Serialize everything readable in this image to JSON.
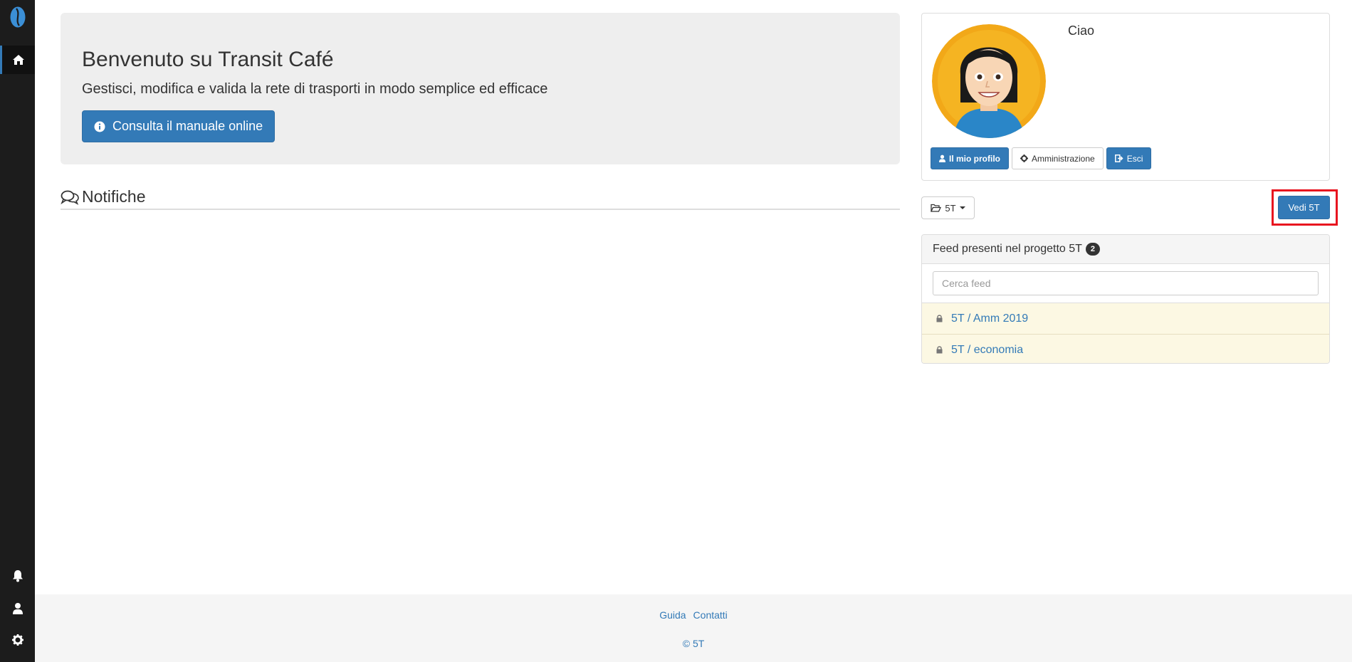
{
  "colors": {
    "sidebar": "#1c1c1c",
    "primary": "#337ab7",
    "highlight": "#e8141f",
    "feed_row": "#fcf8e3"
  },
  "sidebar": {
    "logo_icon": "coffee-bean-icon",
    "items": [
      {
        "icon": "home-icon"
      },
      {
        "icon": "bell-icon"
      },
      {
        "icon": "user-icon"
      },
      {
        "icon": "gear-icon"
      }
    ]
  },
  "jumbotron": {
    "title": "Benvenuto su Transit Café",
    "subtitle": "Gestisci, modifica e valida la rete di trasporti in modo semplice ed efficace",
    "manual_button": "Consulta il manuale online"
  },
  "notifications": {
    "title": "Notifiche"
  },
  "profile": {
    "greeting": "Ciao",
    "buttons": {
      "profile": "Il mio profilo",
      "admin": "Amministrazione",
      "logout": "Esci"
    }
  },
  "project": {
    "selected": "5T",
    "view_button": "Vedi 5T"
  },
  "feeds": {
    "header": "Feed presenti nel progetto 5T",
    "count": "2",
    "search_placeholder": "Cerca feed",
    "items": [
      {
        "label": "5T / Amm 2019"
      },
      {
        "label": "5T / economia"
      }
    ]
  },
  "footer": {
    "links": [
      "Guida",
      "Contatti"
    ],
    "copyright_symbol": "©",
    "copyright_link": "5T"
  }
}
